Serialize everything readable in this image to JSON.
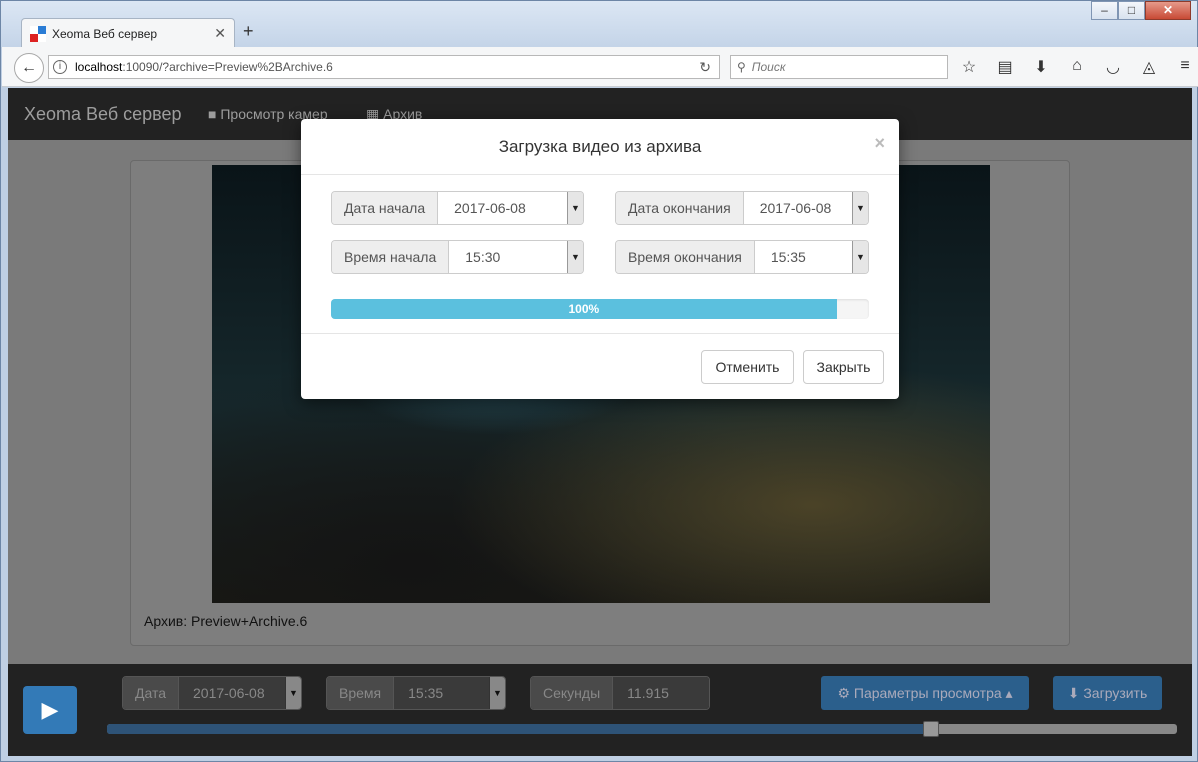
{
  "browser": {
    "tab_title": "Xeoma Веб сервер",
    "new_tab": "+",
    "url_host": "localhost",
    "url_rest": ":10090/?archive=Preview%2BArchive.6",
    "search_placeholder": "Поиск",
    "window_controls": [
      "–",
      "□",
      "✕"
    ]
  },
  "app": {
    "brand": "Xeoma Веб сервер",
    "nav": [
      "Просмотр камер",
      "Архив"
    ],
    "archive_label": "Архив: Preview+Archive.6"
  },
  "bottom": {
    "date_label": "Дата",
    "date_value": "2017-06-08",
    "time_label": "Время",
    "time_value": "15:35",
    "seconds_label": "Секунды",
    "seconds_value": "11.915",
    "params_button": "⚙ Параметры просмотра ▴",
    "download_button": "⬇ Загрузить",
    "slider_position": 0.77
  },
  "modal": {
    "title": "Загрузка видео из архива",
    "close": "×",
    "start_date_label": "Дата начала",
    "start_date_value": "2017-06-08",
    "end_date_label": "Дата окончания",
    "end_date_value": "2017-06-08",
    "start_time_label": "Время начала",
    "start_time_value": "15:30",
    "end_time_label": "Время окончания",
    "end_time_value": "15:35",
    "progress_percent": 94,
    "progress_text": "100%",
    "cancel_button": "Отменить",
    "close_button": "Закрыть"
  },
  "icons": {
    "back": "arrow-left-icon",
    "reload": "reload-icon",
    "search": "search-icon",
    "bookmark": "star-icon",
    "play": "play-icon"
  }
}
